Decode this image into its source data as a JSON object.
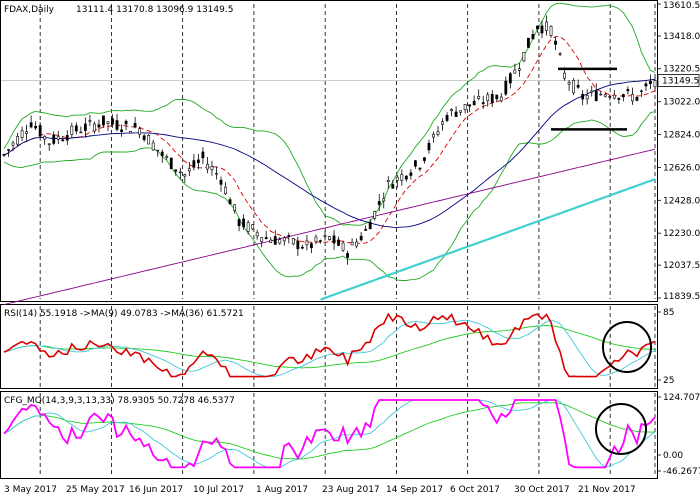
{
  "header": {
    "symbol": "FDAX,Daily",
    "ohlc": "13111.4 13170.8 13096.9 13149.5"
  },
  "current_price": "13149.5",
  "rsi_header": "RSI(14) 55.1918 ->MA(9) 49.0783 ->MA(36) 61.5721",
  "cfg_header": "CFG_MO(14,3,9,3,13,33) 78.9305 50.7278 46.5377",
  "price_axis": [
    "13610.5",
    "13418.0",
    "13220.5",
    "13022.0",
    "12824.0",
    "12626.0",
    "12428.0",
    "12230.0",
    "12037.5",
    "11839.5"
  ],
  "rsi_axis": [
    "85",
    "25"
  ],
  "cfg_axis": [
    "124.7071",
    "0.00",
    "-46.2677"
  ],
  "date_axis": [
    "3 May 2017",
    "25 May 2017",
    "16 Jun 2017",
    "10 Jul 2017",
    "1 Aug 2017",
    "23 Aug 2017",
    "14 Sep 2017",
    "6 Oct 2017",
    "30 Oct 2017",
    "21 Nov 2017"
  ],
  "colors": {
    "candle": "#000000",
    "bollinger": "#22aa22",
    "ma_fast": "#dd0000",
    "ma_blue": "#000080",
    "ma_purple": "#880088",
    "ma_cyan": "#40d0d0",
    "rsi": "#dd0000",
    "rsi_ma9": "#40c8d8",
    "rsi_ma36": "#22cc22",
    "cfg_main": "#ff00ff",
    "cfg_sig1": "#40c8d8",
    "cfg_sig2": "#22cc22",
    "annotation": "#000000"
  }
}
